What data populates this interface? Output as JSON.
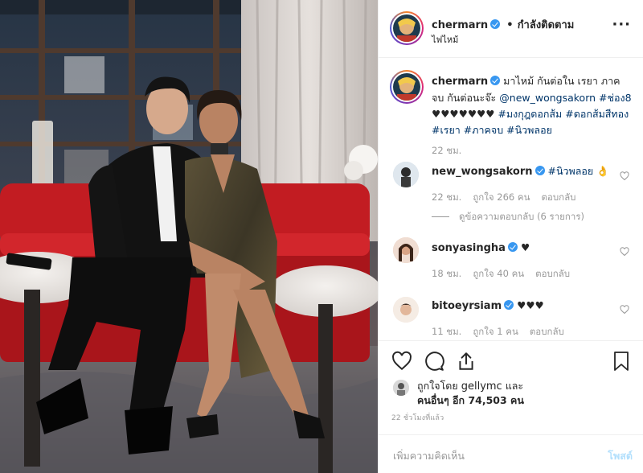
{
  "post": {
    "author": "chermarn",
    "follow_label": "กำลังติดตาม",
    "separator": "•",
    "location": "ไฟไหม้",
    "more_icon": "more-horizontal-icon"
  },
  "caption": {
    "author": "chermarn",
    "text_1": "มาไหม้ กันต่อใน เรยา ภาค",
    "text_2": "จบ กันต่อนะจ๊ะ",
    "mention": "@new_wongsakorn",
    "hashtag_1": "#ช่อง8",
    "hearts": "♥♥♥♥♥♥♥",
    "hashtag_2": "#มงกุฎดอกส้ม",
    "hashtag_3a": "#ดอก",
    "hashtag_3b": "ส้มสีทอง",
    "hashtag_4": "#เรยา",
    "hashtag_5": "#ภาคจบ",
    "hashtag_6": "#นิวพลอย",
    "time": "22 ชม."
  },
  "comments": [
    {
      "user": "new_wongsakorn",
      "text": "#นิวพลอย",
      "emoji": "👌",
      "time": "22 ชม.",
      "likes": "ถูกใจ 266 คน",
      "reply": "ตอบกลับ",
      "view_replies": "ดูข้อความตอบกลับ (6 รายการ)"
    },
    {
      "user": "sonyasingha",
      "text": "♥",
      "time": "18 ชม.",
      "likes": "ถูกใจ 40 คน",
      "reply": "ตอบกลับ"
    },
    {
      "user": "bitoeyrsiam",
      "text": "♥♥♥",
      "time": "11 ชม.",
      "likes": "ถูกใจ 1 คน",
      "reply": "ตอบกลับ"
    }
  ],
  "likes": {
    "line1_prefix": "ถูกใจโดย",
    "line1_user": "gellymc",
    "line1_suffix": "และ",
    "line2": "คนอื่นๆ อีก 74,503 คน"
  },
  "timestamp": "22 ชั่วโมงที่แล้ว",
  "add_comment": {
    "placeholder": "เพิ่มความคิดเห็น",
    "post_label": "โพสต์"
  },
  "icons": {
    "like": "heart-icon",
    "comment": "comment-icon",
    "share": "share-icon",
    "save": "bookmark-icon"
  },
  "colors": {
    "link": "#003569",
    "verified": "#3897f0",
    "muted": "#999999",
    "post_disabled": "#b2dffc"
  }
}
